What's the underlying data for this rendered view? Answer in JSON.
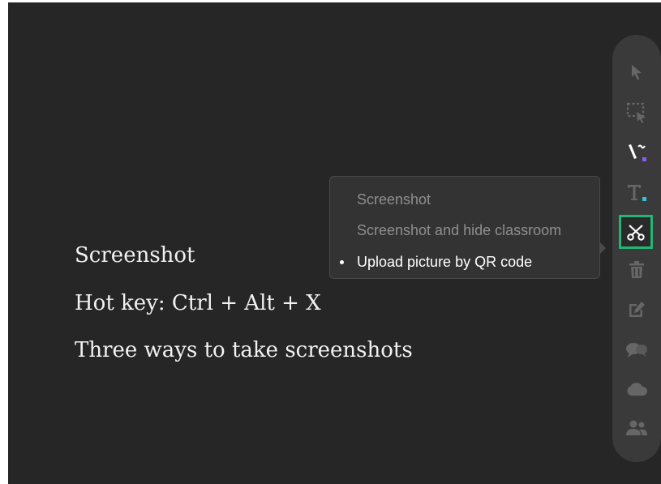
{
  "captions": {
    "title": "Screenshot",
    "hotkey": "Hot key: Ctrl + Alt + X",
    "description": "Three ways to take screenshots"
  },
  "screenshot_menu": {
    "items": [
      {
        "label": "Screenshot",
        "active": false
      },
      {
        "label": "Screenshot and hide classroom",
        "active": false
      },
      {
        "label": "Upload picture by QR code",
        "active": true
      }
    ]
  },
  "toolbar": {
    "tools": [
      {
        "icon": "cursor-arrow-icon",
        "selected": false
      },
      {
        "icon": "selection-box-icon",
        "selected": false
      },
      {
        "icon": "pen-icon",
        "selected": false
      },
      {
        "icon": "text-tool-icon",
        "selected": false
      },
      {
        "icon": "scissors-icon",
        "selected": true
      },
      {
        "icon": "trash-icon",
        "selected": false
      },
      {
        "icon": "edit-icon",
        "selected": false
      },
      {
        "icon": "chat-icon",
        "selected": false
      },
      {
        "icon": "cloud-icon",
        "selected": false
      },
      {
        "icon": "users-icon",
        "selected": false
      }
    ]
  },
  "colors": {
    "background": "#262626",
    "toolbar": "#3a3a3a",
    "selected_outline": "#22b573",
    "icon_dim": "#666666",
    "pen_accent": "#8a5cf6",
    "text_accent": "#2ec4d6"
  }
}
